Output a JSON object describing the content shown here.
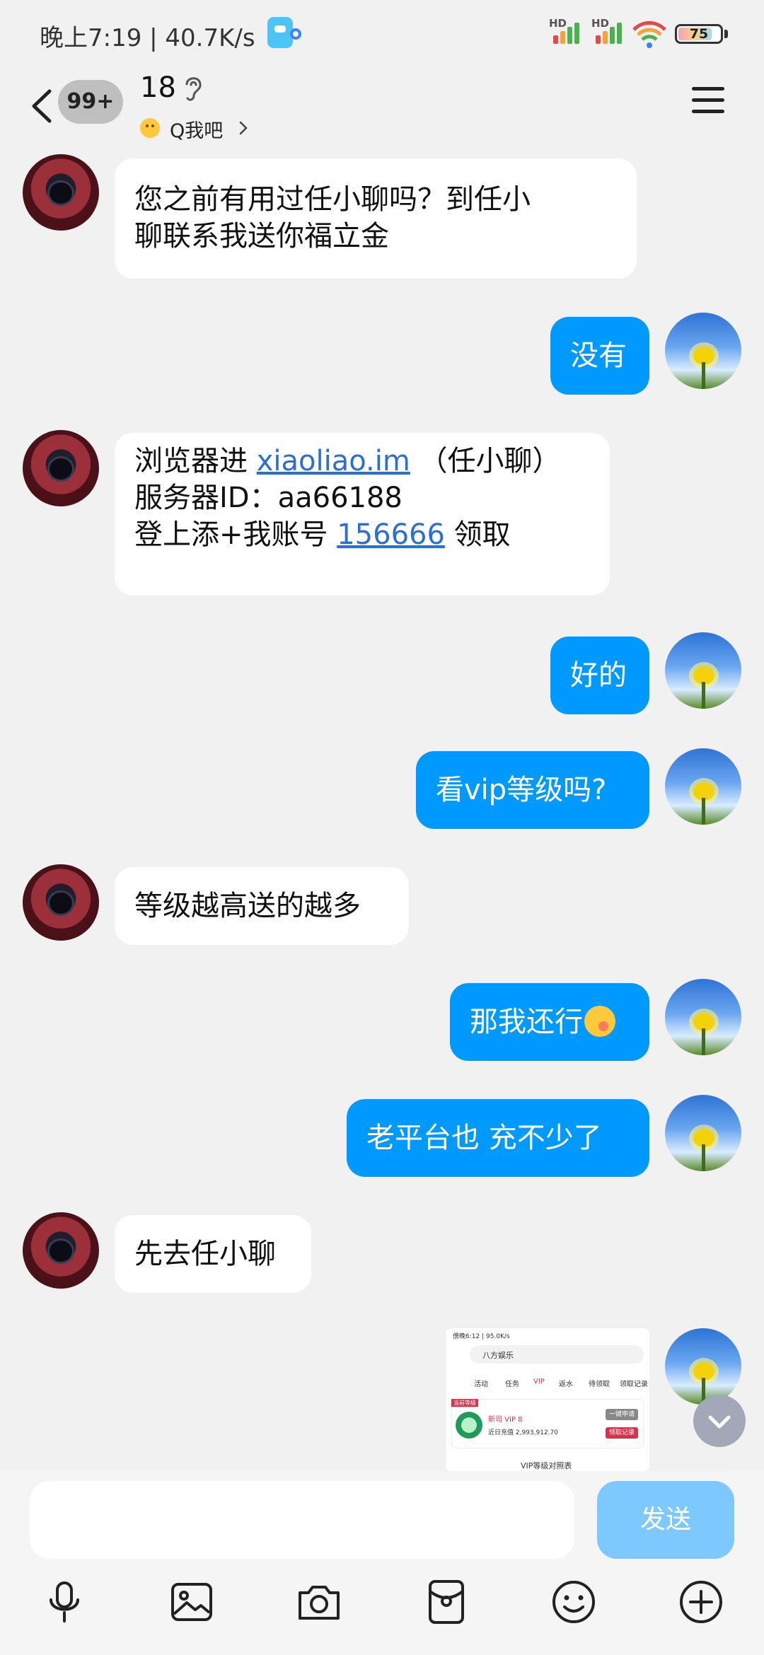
{
  "status_bar": {
    "time_speed": "晚上7:19 | 40.7K/s",
    "signal_1_label": "HD",
    "signal_2_label": "HD",
    "battery": "75"
  },
  "header": {
    "unread_count": "99+",
    "title": "18",
    "subtitle": "Q我吧"
  },
  "messages": [
    {
      "side": "in",
      "lines": [
        "您之前有用过任小聊吗？到任小",
        "聊联系我送你福立金"
      ]
    },
    {
      "side": "out",
      "text": "没有"
    },
    {
      "side": "in",
      "line1_prefix": "浏览器进 ",
      "link_domain": "xiaoliao.im",
      "line1_suffix": "（任小聊）",
      "line2": "服务器ID：aa66188",
      "line3_prefix": "登上添+我账号 ",
      "link_account": "156666",
      "line3_suffix": " 领取"
    },
    {
      "side": "out",
      "text": "好的"
    },
    {
      "side": "out",
      "text": "看vip等级吗?"
    },
    {
      "side": "in",
      "text": "等级越高送的越多"
    },
    {
      "side": "out",
      "text": "那我还行",
      "emoji": "laughing-face"
    },
    {
      "side": "out",
      "text": "老平台也 充不少了"
    },
    {
      "side": "in",
      "text": "先去任小聊"
    }
  ],
  "image_message": {
    "status": "傍晚6:12 | 95.0K/s",
    "app_name": "八方娱乐",
    "tabs": [
      "活动",
      "任务",
      "VIP",
      "返水",
      "待领取",
      "领取记录"
    ],
    "level_tag": "当前等级",
    "vip_label": "新司 VIP 8",
    "deposit_label": "近日充值 2,993,912.70",
    "btn_apply": "一键申请",
    "btn_record": "领取记录",
    "footer": "VIP等级对照表"
  },
  "input": {
    "placeholder": "",
    "send_label": "发送"
  },
  "toolbar_icons": [
    "microphone-icon",
    "image-icon",
    "camera-icon",
    "red-packet-icon",
    "emoji-icon",
    "plus-icon"
  ],
  "colors": {
    "outgoing_bubble": "#0099ff",
    "incoming_bubble": "#ffffff",
    "link": "#2a6fd1",
    "send_button": "#7cc8ff",
    "background": "#f1f1f1"
  }
}
